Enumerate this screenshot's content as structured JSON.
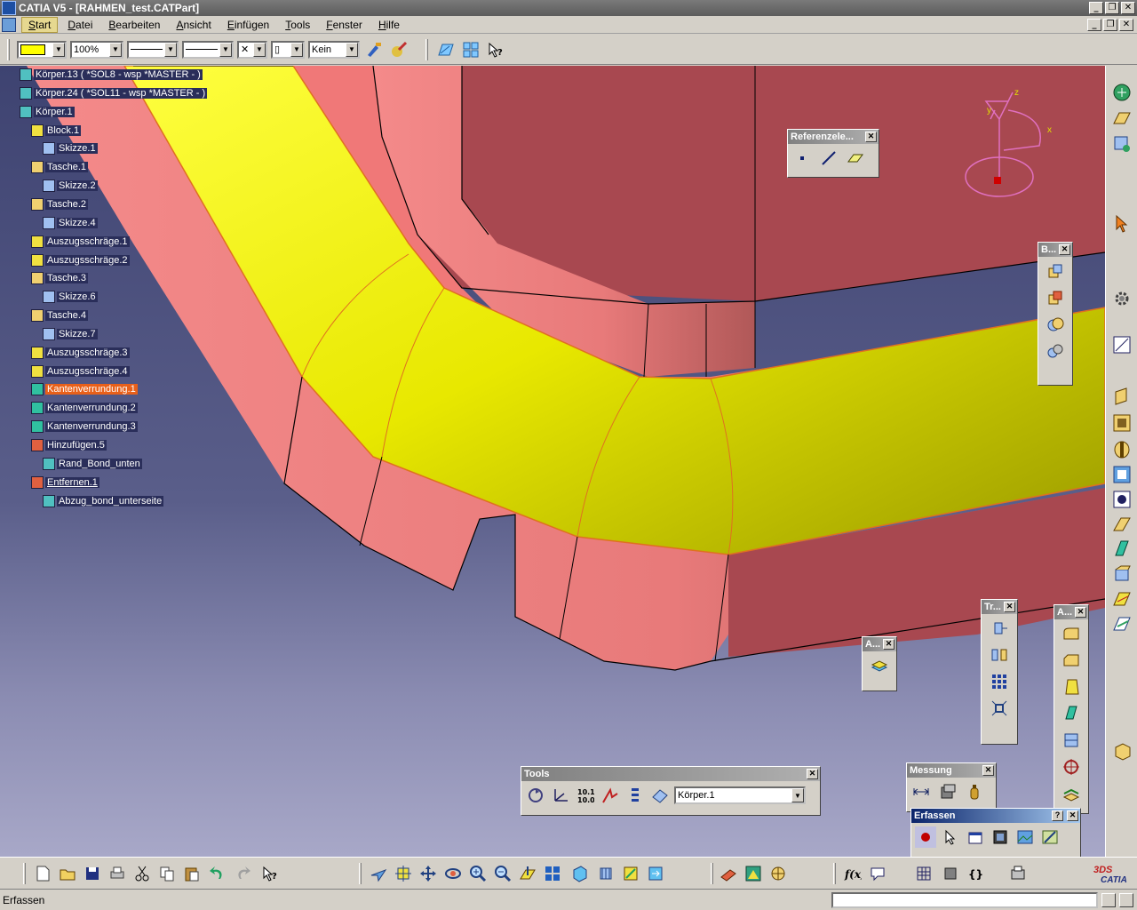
{
  "window": {
    "title": "CATIA V5 - [RAHMEN_test.CATPart]",
    "minimize": "_",
    "restore": "❐",
    "close": "✕"
  },
  "menu": {
    "items": [
      "Start",
      "Datei",
      "Bearbeiten",
      "Ansicht",
      "Einfügen",
      "Tools",
      "Fenster",
      "Hilfe"
    ],
    "active_index": 0
  },
  "toolbar": {
    "color": "#ffff00",
    "transparency": "100%",
    "layer": "Kein"
  },
  "tree": {
    "rows": [
      {
        "label": "Körper.13 ( *SOL8 - wsp *MASTER - )",
        "level": 0,
        "icon": "body-icon"
      },
      {
        "label": "Körper.24 ( *SOL11 - wsp *MASTER - )",
        "level": 0,
        "icon": "body-icon"
      },
      {
        "label": "Körper.1",
        "level": 0,
        "icon": "body-icon"
      },
      {
        "label": "Block.1",
        "level": 1,
        "icon": "pad-icon"
      },
      {
        "label": "Skizze.1",
        "level": 2,
        "icon": "sketch-icon"
      },
      {
        "label": "Tasche.1",
        "level": 1,
        "icon": "pocket-icon"
      },
      {
        "label": "Skizze.2",
        "level": 2,
        "icon": "sketch-icon"
      },
      {
        "label": "Tasche.2",
        "level": 1,
        "icon": "pocket-icon"
      },
      {
        "label": "Skizze.4",
        "level": 2,
        "icon": "sketch-icon"
      },
      {
        "label": "Auszugsschräge.1",
        "level": 1,
        "icon": "draft-icon"
      },
      {
        "label": "Auszugsschräge.2",
        "level": 1,
        "icon": "draft-icon"
      },
      {
        "label": "Tasche.3",
        "level": 1,
        "icon": "pocket-icon"
      },
      {
        "label": "Skizze.6",
        "level": 2,
        "icon": "sketch-icon"
      },
      {
        "label": "Tasche.4",
        "level": 1,
        "icon": "pocket-icon"
      },
      {
        "label": "Skizze.7",
        "level": 2,
        "icon": "sketch-icon"
      },
      {
        "label": "Auszugsschräge.3",
        "level": 1,
        "icon": "draft-icon"
      },
      {
        "label": "Auszugsschräge.4",
        "level": 1,
        "icon": "draft-icon"
      },
      {
        "label": "Kantenverrundung.1",
        "level": 1,
        "icon": "fillet-icon",
        "selected": true
      },
      {
        "label": "Kantenverrundung.2",
        "level": 1,
        "icon": "fillet-icon"
      },
      {
        "label": "Kantenverrundung.3",
        "level": 1,
        "icon": "fillet-icon"
      },
      {
        "label": "Hinzufügen.5",
        "level": 1,
        "icon": "add-icon"
      },
      {
        "label": "Rand_Bond_unten",
        "level": 2,
        "icon": "body-icon"
      },
      {
        "label": "Entfernen.1",
        "level": 1,
        "icon": "remove-icon",
        "underline": true
      },
      {
        "label": "Abzug_bond_unterseite",
        "level": 2,
        "icon": "body-icon"
      }
    ]
  },
  "compass": {
    "x": "x",
    "y": "y",
    "z": "z"
  },
  "palettes": {
    "referenz": {
      "title": "Referenzele...",
      "close": "✕"
    },
    "b": {
      "title": "B...",
      "close": "✕"
    },
    "a1": {
      "title": "A...",
      "close": "✕"
    },
    "tr": {
      "title": "Tr...",
      "close": "✕"
    },
    "a2": {
      "title": "A...",
      "close": "✕"
    },
    "tools": {
      "title": "Tools",
      "close": "✕",
      "body_value": "Körper.1"
    },
    "messung": {
      "title": "Messung",
      "close": "✕"
    },
    "erfassen": {
      "title": "Erfassen",
      "help": "?",
      "close": "✕"
    }
  },
  "status": {
    "text": "Erfassen"
  },
  "colors": {
    "part": "#f07878",
    "part_dark": "#a84850",
    "highlight": "#f0f000",
    "highlight_dark": "#a8a800",
    "selected_row": "#e8601a"
  }
}
